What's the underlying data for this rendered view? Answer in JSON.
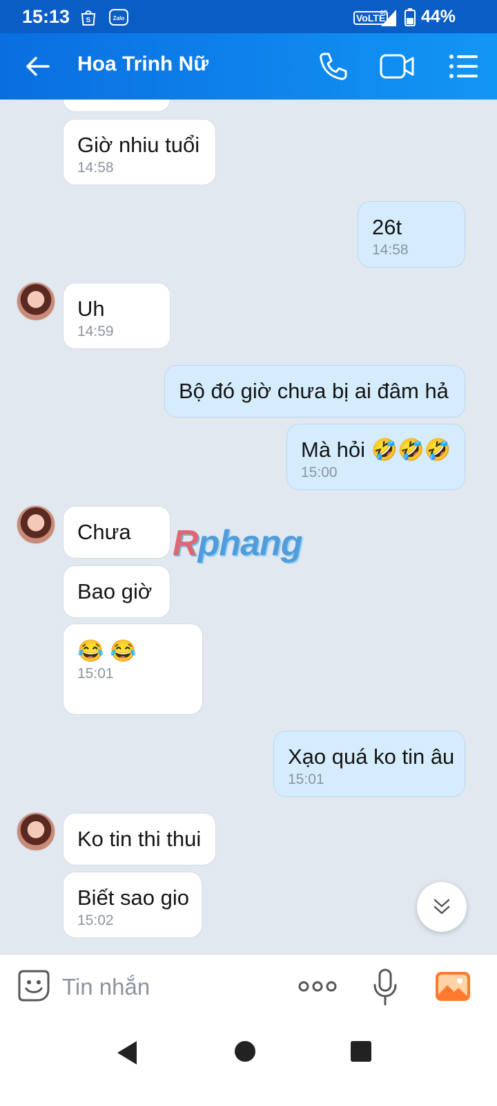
{
  "status_bar": {
    "time": "15:13",
    "network": "VoLTE",
    "network_type": "4G",
    "battery": "44%",
    "icons": [
      "shopee-icon",
      "zalo-icon",
      "signal-icon",
      "battery-icon"
    ]
  },
  "header": {
    "title": "Hoa Trinh Nữ",
    "icons": [
      "back-icon",
      "call-icon",
      "video-call-icon",
      "menu-icon"
    ]
  },
  "messages": [
    {
      "from": "them",
      "text": "Giờ nhiu tuổi",
      "time": "14:58"
    },
    {
      "from": "me",
      "text": "26t",
      "time": "14:58"
    },
    {
      "from": "them",
      "text": "Uh",
      "time": "14:59"
    },
    {
      "from": "me",
      "text": "Bộ đó giờ chưa bị ai đâm hả",
      "time": ""
    },
    {
      "from": "me",
      "text": "Mà hỏi 🤣🤣🤣",
      "time": "15:00"
    },
    {
      "from": "them",
      "text": "Chưa",
      "time": ""
    },
    {
      "from": "them",
      "text": "Bao giờ",
      "time": ""
    },
    {
      "from": "them",
      "text": "😂 😂",
      "time": "15:01"
    },
    {
      "from": "me",
      "text": "Xạo quá ko tin âu",
      "time": "15:01"
    },
    {
      "from": "them",
      "text": "Ko tin thi thui",
      "time": ""
    },
    {
      "from": "them",
      "text": "Biết sao gio",
      "time": "15:02"
    }
  ],
  "watermark": {
    "part1": "R",
    "part2": "phang"
  },
  "composer": {
    "placeholder": "Tin nhắn",
    "icons": [
      "sticker-icon",
      "more-icon",
      "mic-icon",
      "image-icon"
    ]
  },
  "colors": {
    "header": "#0a6ee0",
    "incoming_bubble": "#ffffff",
    "outgoing_bubble": "#d4ecfc",
    "chat_background": "#e2e8f0"
  }
}
